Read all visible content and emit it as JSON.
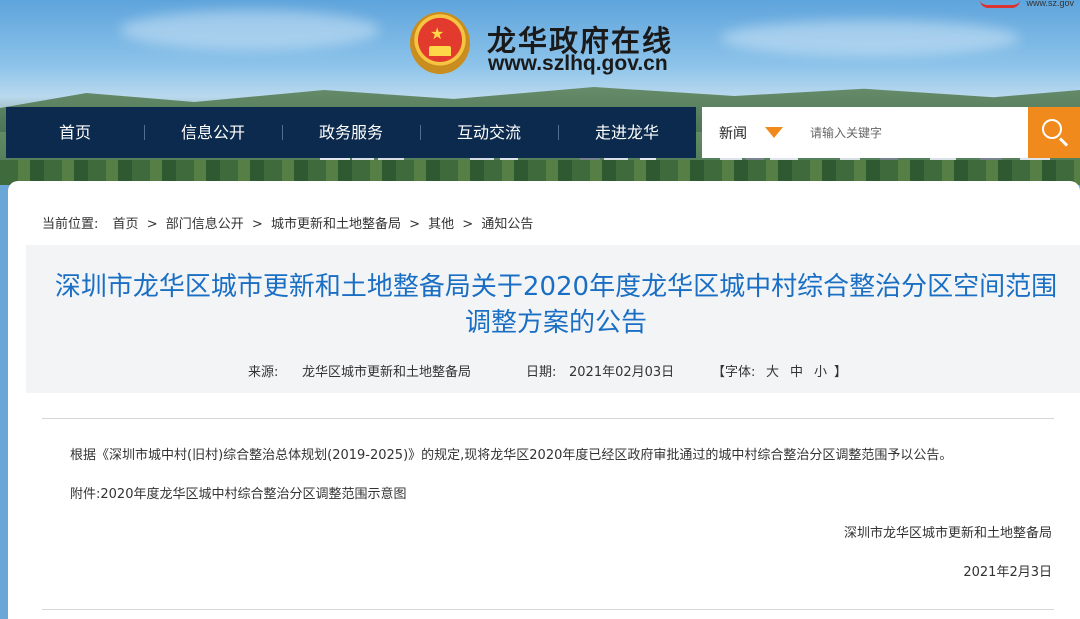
{
  "header": {
    "site_title": "龙华政府在线",
    "site_url": "www.szlhq.gov.cn",
    "corner_logo": "www.sz.gov"
  },
  "nav": {
    "items": [
      "首页",
      "信息公开",
      "政务服务",
      "互动交流",
      "走进龙华"
    ]
  },
  "search": {
    "category": "新闻",
    "placeholder": "请输入关键字",
    "button_icon": "search-icon"
  },
  "breadcrumb": {
    "prefix": "当前位置:",
    "items": [
      "首页",
      "部门信息公开",
      "城市更新和土地整备局",
      "其他",
      "通知公告"
    ],
    "separator": ">"
  },
  "article": {
    "title_line1": "深圳市龙华区城市更新和土地整备局关于2020年度龙华区城中村综合整治分区空间范围",
    "title_line2": "调整方案的公告",
    "source_label": "来源:",
    "source": "龙华区城市更新和土地整备局",
    "date_label": "日期:",
    "date": "2021年02月03日",
    "font_label": "【字体:",
    "font_large": "大",
    "font_medium": "中",
    "font_small": "小",
    "font_close": "】",
    "body": "根据《深圳市城中村(旧村)综合整治总体规划(2019-2025)》的规定,现将龙华区2020年度已经区政府审批通过的城中村综合整治分区调整范围予以公告。",
    "attachment": "附件:2020年度龙华区城中村综合整治分区调整范围示意图",
    "signature": "深圳市龙华区城市更新和土地整备局",
    "signed_date": "2021年2月3日"
  },
  "colors": {
    "nav_bg": "#0b2a4d",
    "accent_orange": "#f08a1c",
    "title_blue": "#1a6fc4"
  }
}
